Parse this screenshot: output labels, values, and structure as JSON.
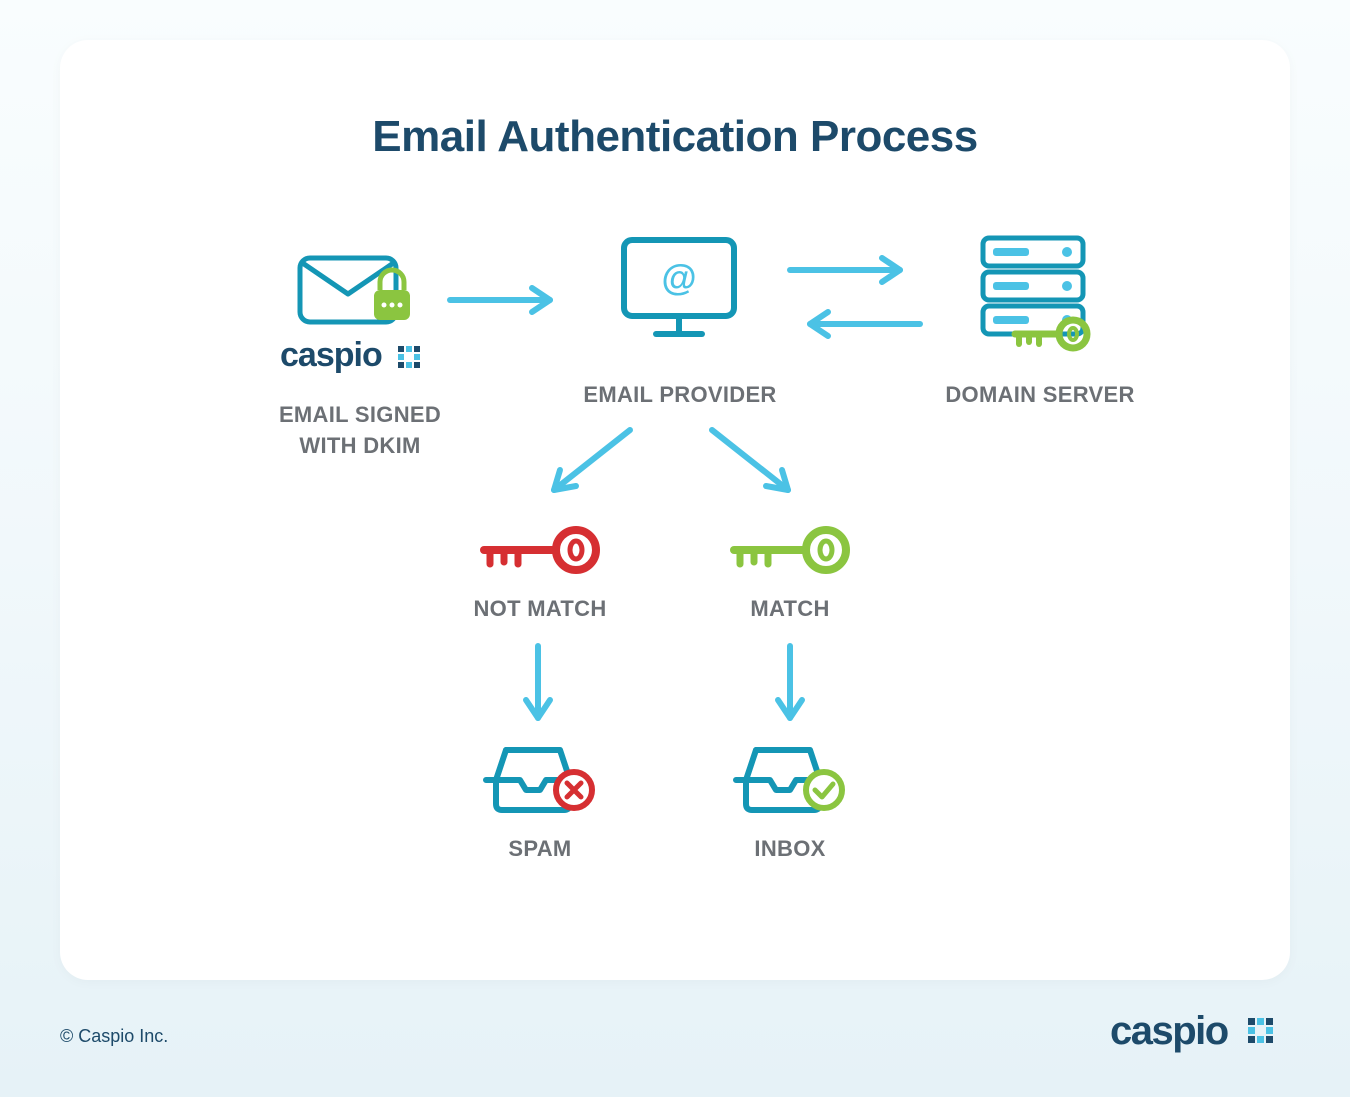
{
  "title": "Email Authentication Process",
  "nodes": {
    "signed": {
      "label_line1": "EMAIL SIGNED",
      "label_line2": "WITH DKIM"
    },
    "provider": {
      "label": "EMAIL PROVIDER",
      "at_symbol": "@"
    },
    "server": {
      "label": "DOMAIN SERVER"
    },
    "notmatch": {
      "label": "NOT MATCH"
    },
    "match": {
      "label": "MATCH"
    },
    "spam": {
      "label": "SPAM"
    },
    "inbox": {
      "label": "INBOX"
    }
  },
  "brand": {
    "name": "caspio"
  },
  "footer": {
    "copyright": "© Caspio Inc."
  },
  "colors": {
    "darkblue": "#1d4a6a",
    "teal": "#1496b5",
    "lightblue": "#4bc2e5",
    "green": "#8bc540",
    "red": "#d62f32",
    "gray": "#6c7075"
  }
}
